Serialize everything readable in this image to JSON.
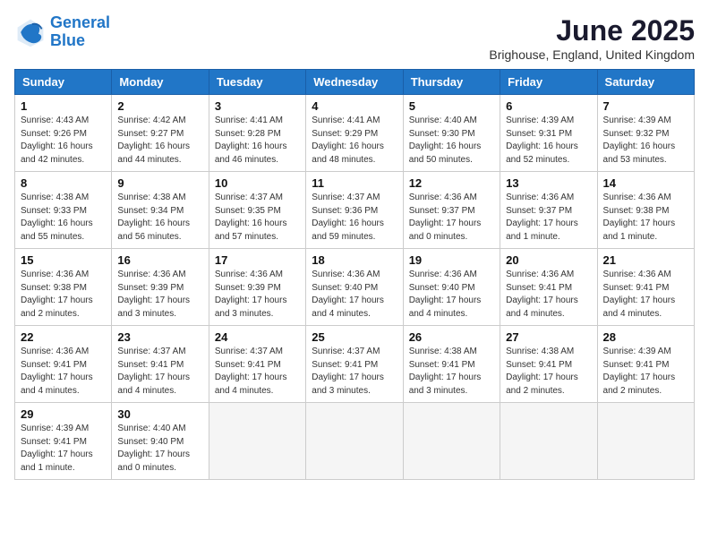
{
  "logo": {
    "line1": "General",
    "line2": "Blue"
  },
  "title": "June 2025",
  "location": "Brighouse, England, United Kingdom",
  "days_of_week": [
    "Sunday",
    "Monday",
    "Tuesday",
    "Wednesday",
    "Thursday",
    "Friday",
    "Saturday"
  ],
  "weeks": [
    [
      {
        "day": 1,
        "info": "Sunrise: 4:43 AM\nSunset: 9:26 PM\nDaylight: 16 hours and 42 minutes."
      },
      {
        "day": 2,
        "info": "Sunrise: 4:42 AM\nSunset: 9:27 PM\nDaylight: 16 hours and 44 minutes."
      },
      {
        "day": 3,
        "info": "Sunrise: 4:41 AM\nSunset: 9:28 PM\nDaylight: 16 hours and 46 minutes."
      },
      {
        "day": 4,
        "info": "Sunrise: 4:41 AM\nSunset: 9:29 PM\nDaylight: 16 hours and 48 minutes."
      },
      {
        "day": 5,
        "info": "Sunrise: 4:40 AM\nSunset: 9:30 PM\nDaylight: 16 hours and 50 minutes."
      },
      {
        "day": 6,
        "info": "Sunrise: 4:39 AM\nSunset: 9:31 PM\nDaylight: 16 hours and 52 minutes."
      },
      {
        "day": 7,
        "info": "Sunrise: 4:39 AM\nSunset: 9:32 PM\nDaylight: 16 hours and 53 minutes."
      }
    ],
    [
      {
        "day": 8,
        "info": "Sunrise: 4:38 AM\nSunset: 9:33 PM\nDaylight: 16 hours and 55 minutes."
      },
      {
        "day": 9,
        "info": "Sunrise: 4:38 AM\nSunset: 9:34 PM\nDaylight: 16 hours and 56 minutes."
      },
      {
        "day": 10,
        "info": "Sunrise: 4:37 AM\nSunset: 9:35 PM\nDaylight: 16 hours and 57 minutes."
      },
      {
        "day": 11,
        "info": "Sunrise: 4:37 AM\nSunset: 9:36 PM\nDaylight: 16 hours and 59 minutes."
      },
      {
        "day": 12,
        "info": "Sunrise: 4:36 AM\nSunset: 9:37 PM\nDaylight: 17 hours and 0 minutes."
      },
      {
        "day": 13,
        "info": "Sunrise: 4:36 AM\nSunset: 9:37 PM\nDaylight: 17 hours and 1 minute."
      },
      {
        "day": 14,
        "info": "Sunrise: 4:36 AM\nSunset: 9:38 PM\nDaylight: 17 hours and 1 minute."
      }
    ],
    [
      {
        "day": 15,
        "info": "Sunrise: 4:36 AM\nSunset: 9:38 PM\nDaylight: 17 hours and 2 minutes."
      },
      {
        "day": 16,
        "info": "Sunrise: 4:36 AM\nSunset: 9:39 PM\nDaylight: 17 hours and 3 minutes."
      },
      {
        "day": 17,
        "info": "Sunrise: 4:36 AM\nSunset: 9:39 PM\nDaylight: 17 hours and 3 minutes."
      },
      {
        "day": 18,
        "info": "Sunrise: 4:36 AM\nSunset: 9:40 PM\nDaylight: 17 hours and 4 minutes."
      },
      {
        "day": 19,
        "info": "Sunrise: 4:36 AM\nSunset: 9:40 PM\nDaylight: 17 hours and 4 minutes."
      },
      {
        "day": 20,
        "info": "Sunrise: 4:36 AM\nSunset: 9:41 PM\nDaylight: 17 hours and 4 minutes."
      },
      {
        "day": 21,
        "info": "Sunrise: 4:36 AM\nSunset: 9:41 PM\nDaylight: 17 hours and 4 minutes."
      }
    ],
    [
      {
        "day": 22,
        "info": "Sunrise: 4:36 AM\nSunset: 9:41 PM\nDaylight: 17 hours and 4 minutes."
      },
      {
        "day": 23,
        "info": "Sunrise: 4:37 AM\nSunset: 9:41 PM\nDaylight: 17 hours and 4 minutes."
      },
      {
        "day": 24,
        "info": "Sunrise: 4:37 AM\nSunset: 9:41 PM\nDaylight: 17 hours and 4 minutes."
      },
      {
        "day": 25,
        "info": "Sunrise: 4:37 AM\nSunset: 9:41 PM\nDaylight: 17 hours and 3 minutes."
      },
      {
        "day": 26,
        "info": "Sunrise: 4:38 AM\nSunset: 9:41 PM\nDaylight: 17 hours and 3 minutes."
      },
      {
        "day": 27,
        "info": "Sunrise: 4:38 AM\nSunset: 9:41 PM\nDaylight: 17 hours and 2 minutes."
      },
      {
        "day": 28,
        "info": "Sunrise: 4:39 AM\nSunset: 9:41 PM\nDaylight: 17 hours and 2 minutes."
      }
    ],
    [
      {
        "day": 29,
        "info": "Sunrise: 4:39 AM\nSunset: 9:41 PM\nDaylight: 17 hours and 1 minute."
      },
      {
        "day": 30,
        "info": "Sunrise: 4:40 AM\nSunset: 9:40 PM\nDaylight: 17 hours and 0 minutes."
      },
      null,
      null,
      null,
      null,
      null
    ]
  ]
}
